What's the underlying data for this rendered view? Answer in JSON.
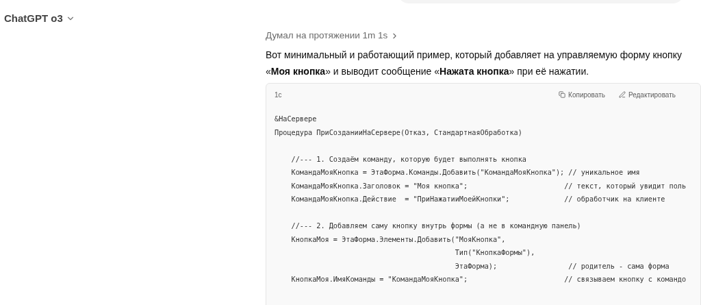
{
  "model_selector": {
    "label": "ChatGPT o3"
  },
  "thinking": {
    "label": "Думал на протяжении 1m 1s"
  },
  "message": "Вот минимальный и работающий пример, который добавляет на управляемую форму кнопку «**Моя кнопка**» и выводит сообщение «**Нажата кнопка**» при её нажатии.",
  "code_block": {
    "language": "1c",
    "copy_label": "Копировать",
    "edit_label": "Редактировать",
    "blocks": [
      [
        "&НаСервере",
        "Процедура ПриСозданииНаСервере(Отказ, СтандартнаяОбработка)"
      ],
      [
        "    //--- 1. Создаём команду, которую будет выполнять кнопка",
        "    КомандаМояКнопка = ЭтаФорма.Команды.Добавить(\"КомандаМояКнопка\"); // уникальное имя",
        "    КомандаМояКнопка.Заголовок = \"Моя кнопка\";                       // текст, который увидит поль",
        "    КомандаМояКнопка.Действие  = \"ПриНажатииМоейКнопки\";             // обработчик на клиенте"
      ],
      [
        "    //--- 2. Добавляем саму кнопку внутрь формы (а не в командную панель)",
        "    КнопкаМоя = ЭтаФорма.Элементы.Добавить(\"МояКнопка\",",
        "                                           Тип(\"КнопкаФормы\"),",
        "                                           ЭтаФорма);                 // родитель - сама форма",
        "    КнопкаМоя.ИмяКоманды = \"КомандаМояКнопка\";                       // связываем кнопку с командо"
      ]
    ]
  }
}
